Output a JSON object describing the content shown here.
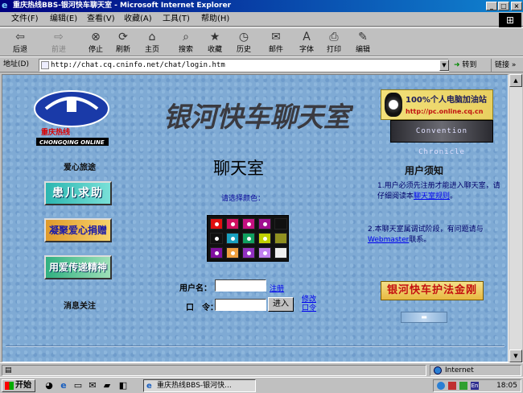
{
  "window": {
    "title": "重庆热线BBS-银河快车聊天室 - Microsoft Internet Explorer",
    "controls": {
      "minimize": "_",
      "maximize": "□",
      "close": "×"
    }
  },
  "menu": [
    "文件(F)",
    "编辑(E)",
    "查看(V)",
    "收藏(A)",
    "工具(T)",
    "帮助(H)"
  ],
  "toolbar": [
    {
      "label": "后退",
      "icon": "back-arrow-icon",
      "glyph": "⇦"
    },
    {
      "label": "前进",
      "icon": "forward-arrow-icon",
      "glyph": "⇨"
    },
    {
      "label": "停止",
      "icon": "stop-icon",
      "glyph": "⊗"
    },
    {
      "label": "刷新",
      "icon": "refresh-icon",
      "glyph": "⟳"
    },
    {
      "label": "主页",
      "icon": "home-icon",
      "glyph": "⌂"
    },
    {
      "label": "搜索",
      "icon": "search-icon",
      "glyph": "⌕"
    },
    {
      "label": "收藏",
      "icon": "favorites-icon",
      "glyph": "★"
    },
    {
      "label": "历史",
      "icon": "history-icon",
      "glyph": "◷"
    },
    {
      "label": "邮件",
      "icon": "mail-icon",
      "glyph": "✉"
    },
    {
      "label": "字体",
      "icon": "font-icon",
      "glyph": "A"
    },
    {
      "label": "打印",
      "icon": "print-icon",
      "glyph": "⎙"
    },
    {
      "label": "编辑",
      "icon": "edit-icon",
      "glyph": "✎"
    }
  ],
  "address": {
    "label": "地址(D)",
    "url": "http://chat.cq.cninfo.net/chat/login.htm",
    "go": "转到",
    "links": "链接 »"
  },
  "page": {
    "logo_text": "重庆热线",
    "logo_sub": "CHONGQING ONLINE",
    "banner_text": "银河快车聊天室",
    "ad1_title": "100%个人电脑加油站",
    "ad1_url": "http://pc.online.cq.cn",
    "ad2_text": "Convention Chronicle",
    "left_header1": "爱心旅途",
    "left_btn1": "患儿求助",
    "left_btn2": "凝聚爱心捐赠",
    "left_btn3": "用爱传递精神",
    "left_header2": "消息关注",
    "title": "聊天室",
    "color_label": "请选择颜色：",
    "palette": [
      [
        "#e01010",
        "#d01060",
        "#c41080",
        "#a01090",
        "#101010"
      ],
      [
        "#101010",
        "#18a0c0",
        "#10a060",
        "#c0d000",
        "#909020"
      ],
      [
        "#8010a0",
        "#f0a040",
        "#9030c0",
        "#c080f0",
        "#f0f0f0"
      ]
    ],
    "username_label": "用户名：",
    "register": "注册",
    "password_label": "口　令：",
    "enter": "进入",
    "change_password": "修改口令",
    "notice_title": "用户须知",
    "notice1_pre": "1.用户必须先注册才能进入聊天室，请仔细阅读本",
    "notice1_link": "聊天室规则",
    "notice1_post": "。",
    "notice2_pre": "2.本聊天室属调试阶段，有问题请与",
    "notice2_link": "Webmaster",
    "notice2_post": "联系。",
    "badge": "银河快车护法金刚"
  },
  "status": {
    "zone": "Internet"
  },
  "taskbar": {
    "start": "开始",
    "item": "重庆热线BBS-银河快...",
    "clock": "18:05"
  },
  "colors": {
    "title_start": "#00007f",
    "title_end": "#1084d0",
    "page_bg": "#7faad4"
  }
}
